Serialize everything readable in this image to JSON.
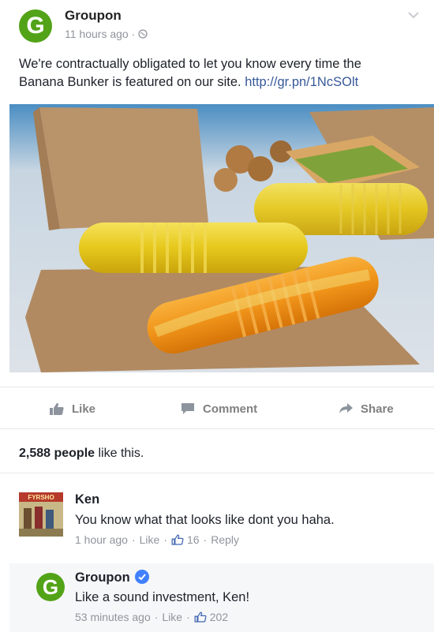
{
  "post": {
    "author": "Groupon",
    "time": "11 hours ago",
    "separator": "·",
    "text_line1": "We're contractually obligated to let you know every time the",
    "text_line2": "Banana Bunker is featured on our site.",
    "link": "http://gr.pn/1NcSOlt",
    "avatar_letter": "G",
    "brand_color": "#53a318",
    "link_color": "#365899"
  },
  "actions": {
    "like": "Like",
    "comment": "Comment",
    "share": "Share"
  },
  "likes": {
    "count": "2,588 people",
    "suffix": " like this."
  },
  "comments": [
    {
      "name": "Ken",
      "text": "You know what that looks like dont you haha.",
      "time": "1 hour ago",
      "like": "Like",
      "likes": "16",
      "reply": "Reply",
      "avatar_label": "FYRSHO"
    },
    {
      "name": "Groupon",
      "text": "Like a sound investment, Ken!",
      "time": "53 minutes ago",
      "like": "Like",
      "likes": "202",
      "avatar_letter": "G",
      "verified": true
    }
  ]
}
